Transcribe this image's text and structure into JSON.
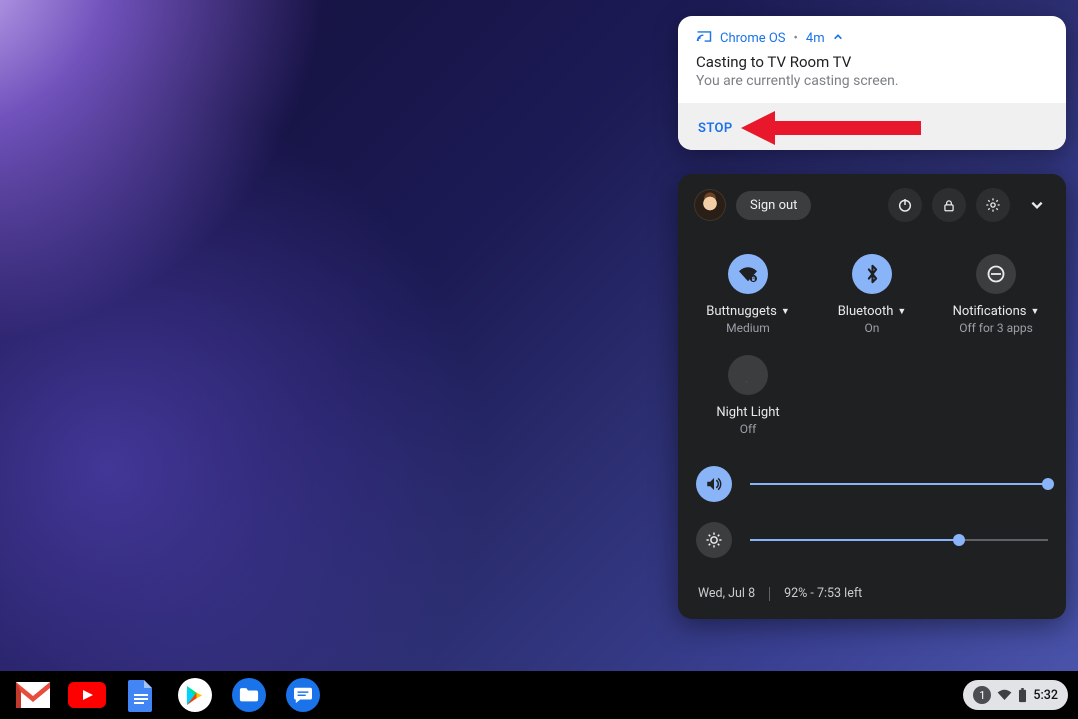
{
  "notification": {
    "source": "Chrome OS",
    "age": "4m",
    "title": "Casting to TV Room TV",
    "subtitle": "You are currently casting screen.",
    "action_stop": "STOP"
  },
  "quick_settings": {
    "signout_label": "Sign out",
    "tiles": {
      "wifi": {
        "label": "Buttnuggets",
        "sub": "Medium",
        "on": true,
        "has_caret": true
      },
      "bt": {
        "label": "Bluetooth",
        "sub": "On",
        "on": true,
        "has_caret": true
      },
      "notif": {
        "label": "Notifications",
        "sub": "Off for 3 apps",
        "on": false,
        "has_caret": true
      },
      "night": {
        "label": "Night Light",
        "sub": "Off",
        "on": false,
        "has_caret": false
      }
    },
    "volume_percent": 100,
    "brightness_percent": 70,
    "date": "Wed, Jul 8",
    "battery_line": "92% - 7:53 left"
  },
  "shelf": {
    "notification_count": "1",
    "clock": "5:32"
  }
}
